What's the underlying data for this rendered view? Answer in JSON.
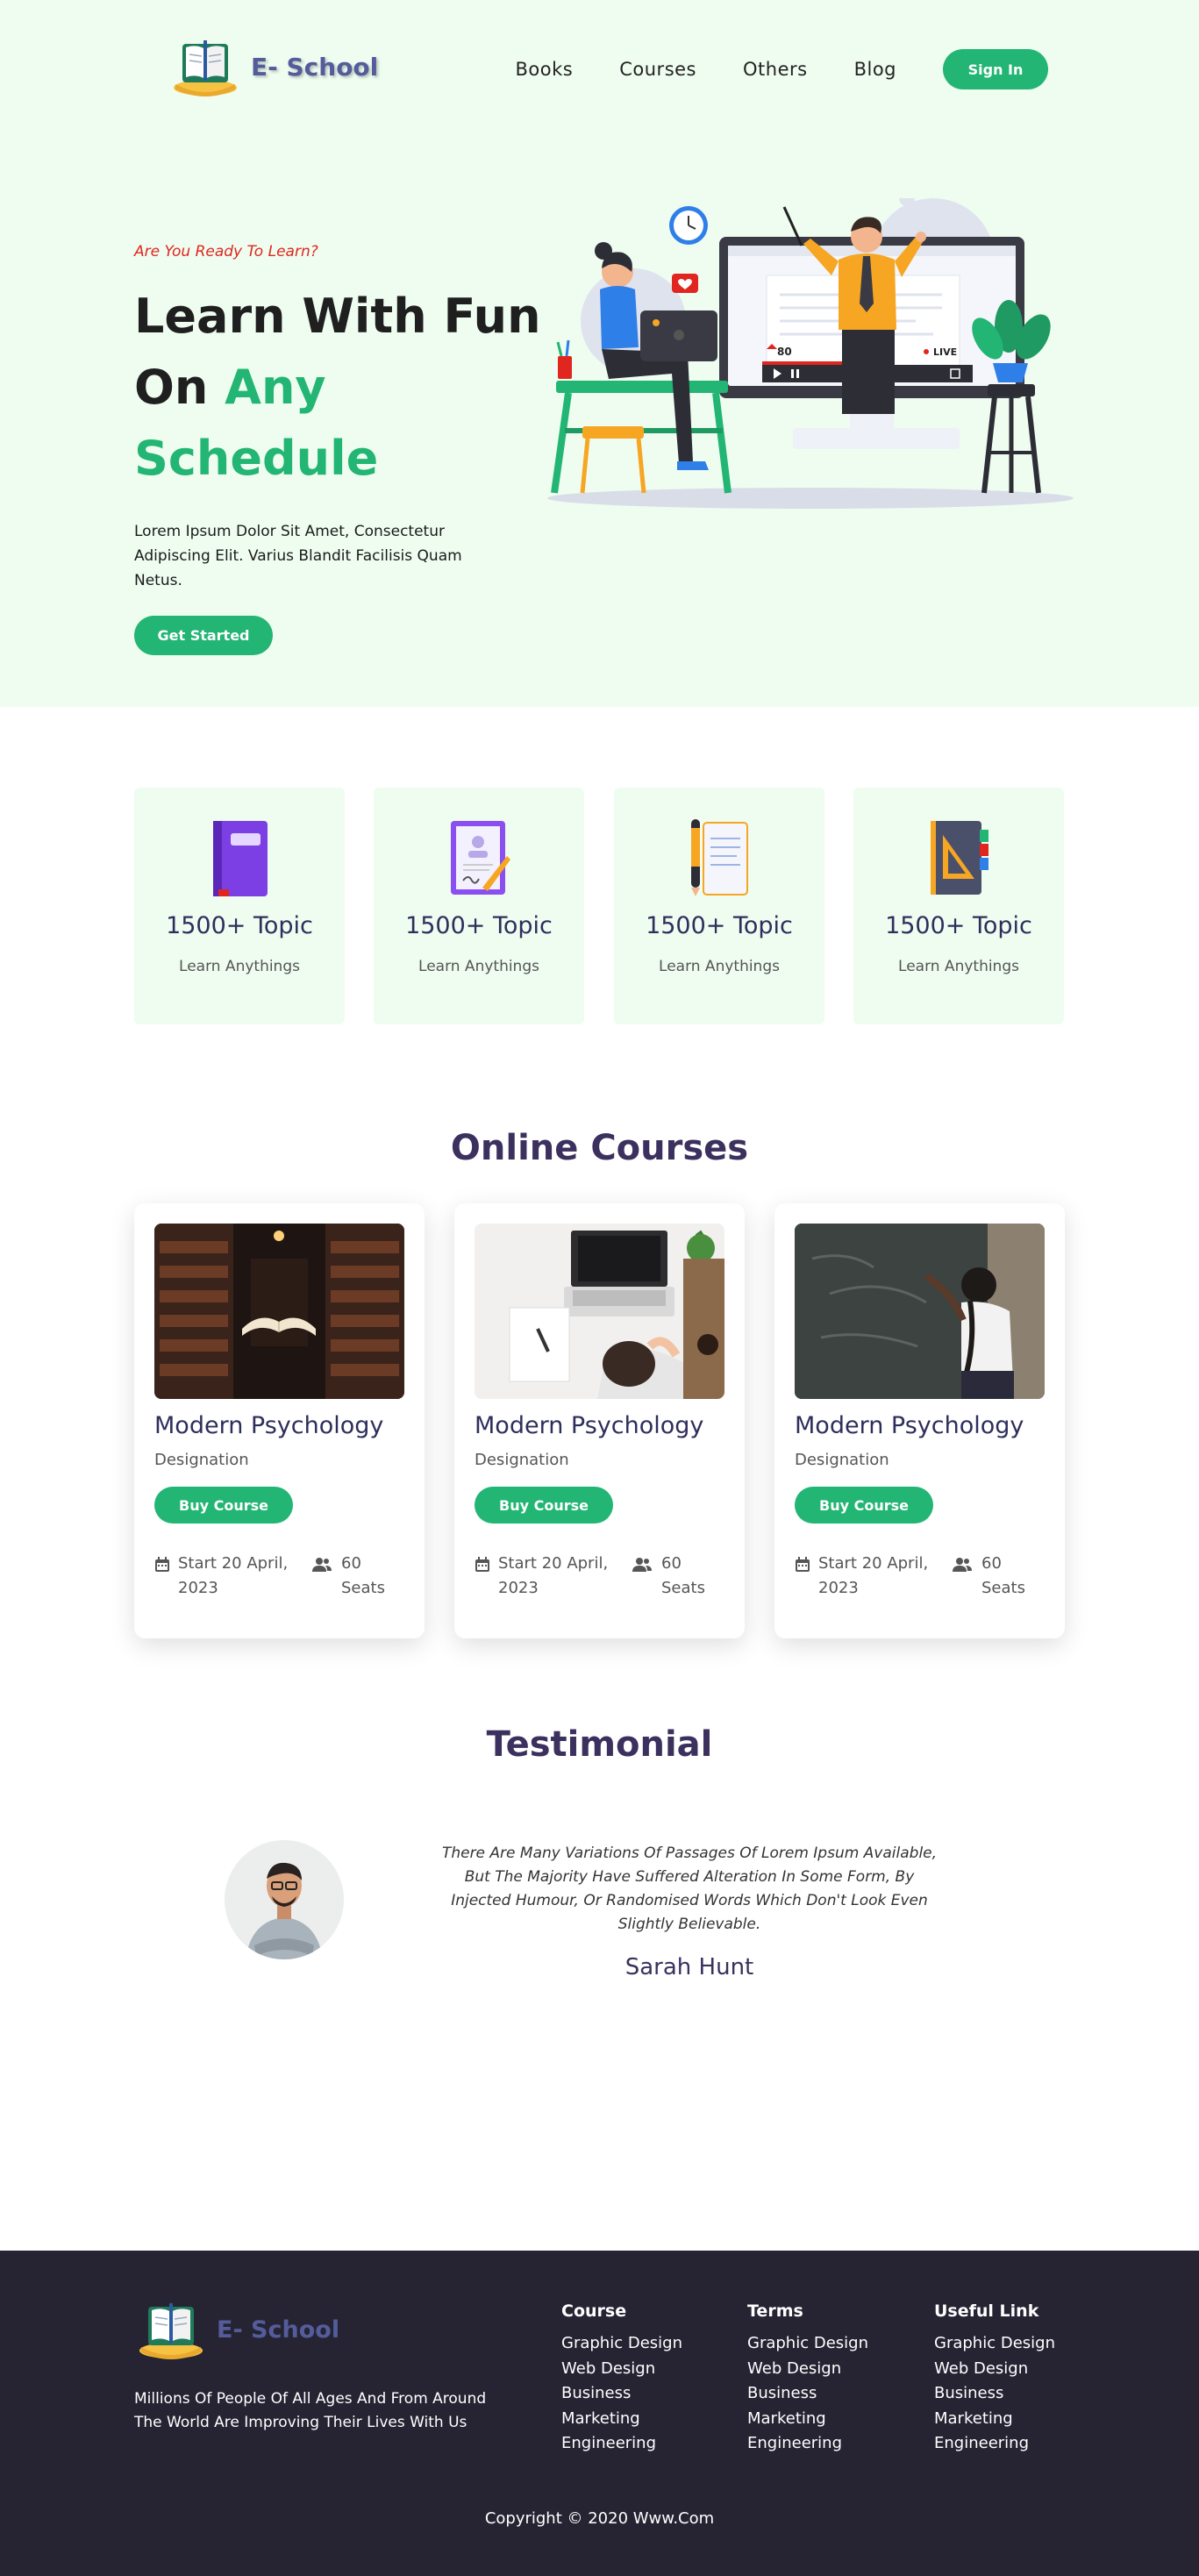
{
  "brand": {
    "name": "E- School",
    "accent_color": "#22b573",
    "logo_text_color": "#545c9c",
    "hero_bg": "#effdf0",
    "footer_bg": "#262433"
  },
  "nav": {
    "links": [
      "Books",
      "Courses",
      "Others",
      "Blog"
    ],
    "signin_label": "Sign In"
  },
  "hero": {
    "eyebrow": "Are You Ready To Learn?",
    "headline_line1": "Learn With Fun",
    "headline_line2_plain": "On ",
    "headline_line2_accent": "Any",
    "headline_line3": "Schedule",
    "body": "Lorem Ipsum Dolor Sit Amet, Consectetur Adipiscing Elit. Varius Blandit Facilisis Quam Netus.",
    "cta_label": "Get Started",
    "illustration_counter": "80",
    "illustration_live": "LIVE"
  },
  "topics": [
    {
      "icon": "purple-book-icon",
      "title": "1500+ Topic",
      "subtitle": "Learn Anythings"
    },
    {
      "icon": "certificate-pen-icon",
      "title": "1500+ Topic",
      "subtitle": "Learn Anythings"
    },
    {
      "icon": "clipboard-pen-icon",
      "title": "1500+ Topic",
      "subtitle": "Learn Anythings"
    },
    {
      "icon": "geometry-notebook-icon",
      "title": "1500+ Topic",
      "subtitle": "Learn Anythings"
    }
  ],
  "courses_section": {
    "title": "Online Courses",
    "cards": [
      {
        "image": "library-book-photo",
        "title": "Modern Psychology",
        "subtitle": "Designation",
        "button": "Buy Course",
        "date_line1": "Start 20 April,",
        "date_line2": "2023",
        "seats_line1": "60",
        "seats_line2": "Seats"
      },
      {
        "image": "laptop-desk-photo",
        "title": "Modern Psychology",
        "subtitle": "Designation",
        "button": "Buy Course",
        "date_line1": "Start 20 April,",
        "date_line2": "2023",
        "seats_line1": "60",
        "seats_line2": "Seats"
      },
      {
        "image": "chalkboard-student-photo",
        "title": "Modern Psychology",
        "subtitle": "Designation",
        "button": "Buy Course",
        "date_line1": "Start 20 April,",
        "date_line2": "2023",
        "seats_line1": "60",
        "seats_line2": "Seats"
      }
    ]
  },
  "testimonial": {
    "title": "Testimonial",
    "quote": "There Are Many Variations Of Passages Of Lorem Ipsum Available, But The Majority Have Suffered Alteration In Some Form, By Injected Humour, Or Randomised Words Which Don't Look Even Slightly Believable.",
    "name": "Sarah Hunt"
  },
  "footer": {
    "logo_text": "E- School",
    "description": "Millions Of People Of All Ages And From Around The World Are Improving Their Lives With Us",
    "columns": [
      {
        "title": "Course",
        "items": [
          "Graphic Design",
          "Web Design",
          "Business",
          "Marketing",
          "Engineering"
        ]
      },
      {
        "title": "Terms",
        "items": [
          "Graphic Design",
          "Web Design",
          "Business",
          "Marketing",
          "Engineering"
        ]
      },
      {
        "title": "Useful Link",
        "items": [
          "Graphic Design",
          "Web Design",
          "Business",
          "Marketing",
          "Engineering"
        ]
      }
    ],
    "copyright": "Copyright © 2020 Www.Com"
  }
}
